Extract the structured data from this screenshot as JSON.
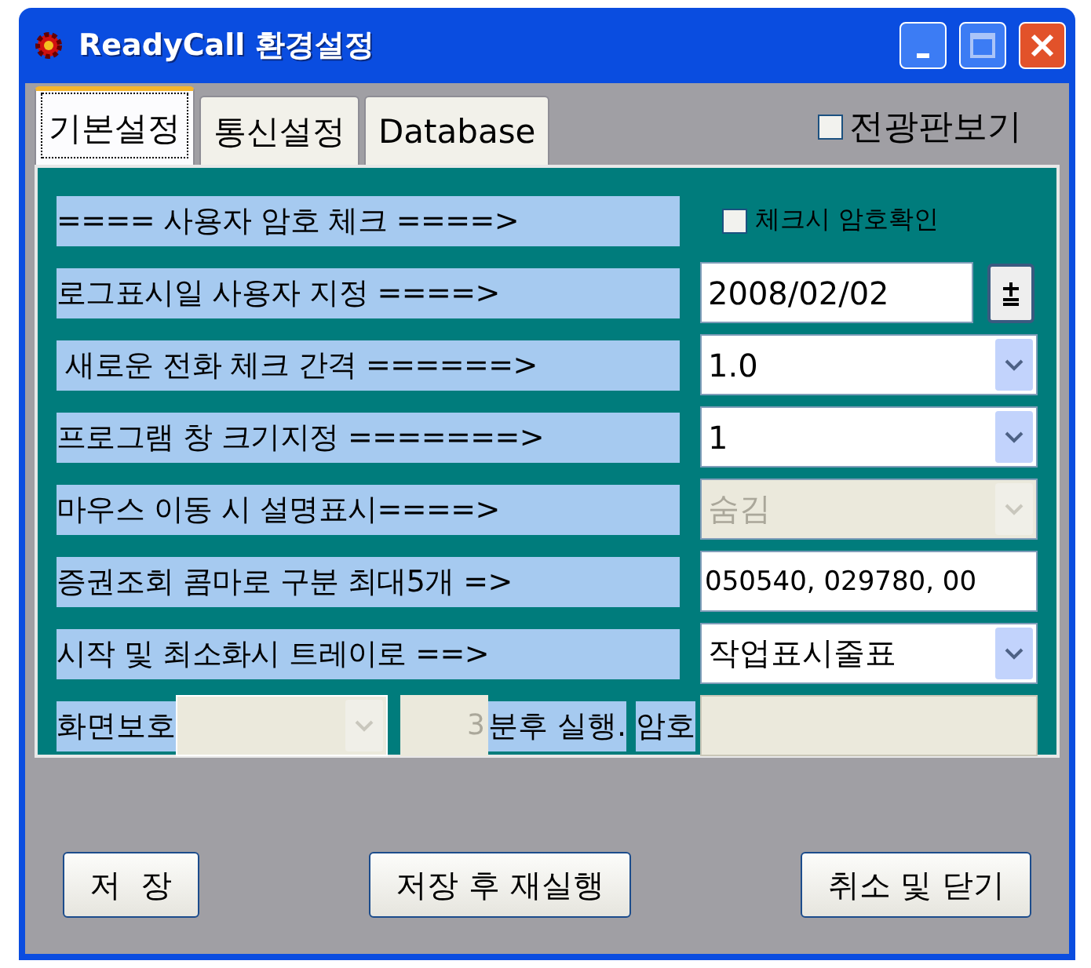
{
  "window": {
    "title": "ReadyCall 환경설정"
  },
  "tabs": [
    {
      "label": "기본설정",
      "selected": true
    },
    {
      "label": "통신설정",
      "selected": false
    },
    {
      "label": "Database",
      "selected": false
    }
  ],
  "board_checkbox": {
    "label": "전광판보기",
    "checked": false
  },
  "settings": [
    {
      "kind": "checkbox",
      "label": "==== 사용자 암호 체크 ====>",
      "option": "체크시 암호확인",
      "checked": false
    },
    {
      "kind": "date",
      "label": "로그표시일 사용자 지정 ====>",
      "value": "2008/02/02"
    },
    {
      "kind": "combo",
      "label": " 새로운 전화 체크 간격 ======>",
      "value": "1.0",
      "disabled": false
    },
    {
      "kind": "combo",
      "label": "프로그램 창 크기지정 =======>",
      "value": "1",
      "disabled": false
    },
    {
      "kind": "combo",
      "label": "마우스 이동 시 설명표시====>",
      "value": "숨김",
      "disabled": true
    },
    {
      "kind": "text",
      "label": "증권조회 콤마로 구분 최대5개 =>",
      "value": "050540, 029780, 00"
    },
    {
      "kind": "combo",
      "label": "시작 및 최소화시 트레이로 ==>",
      "value": "작업표시줄표",
      "disabled": false
    }
  ],
  "screensaver": {
    "label": "화면보호",
    "combo_disabled": true,
    "minutes": "3",
    "after_label": "분후 실행.",
    "password_label": "암호"
  },
  "buttons": [
    "저  장",
    "저장 후 재실행",
    "취소 및 닫기"
  ]
}
